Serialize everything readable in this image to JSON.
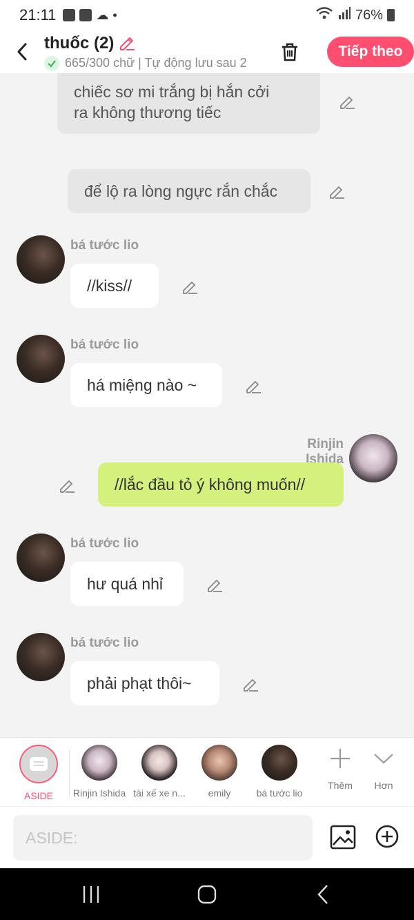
{
  "status": {
    "time": "21:11",
    "battery": "76%"
  },
  "header": {
    "title": "thuốc (2)",
    "subtitle": "665/300 chữ | Tự động lưu sau 2",
    "next_label": "Tiếp theo"
  },
  "messages": [
    {
      "type": "aside",
      "text_lines": [
        "chiếc sơ mi trắng bị hắn cởi",
        "ra không thương tiếc"
      ]
    },
    {
      "type": "aside",
      "text": "để lộ ra lòng ngực rắn chắc"
    },
    {
      "type": "left",
      "sender": "bá tước lio",
      "text": "//kiss//"
    },
    {
      "type": "left",
      "sender": "bá tước lio",
      "text": "há miệng nào ~"
    },
    {
      "type": "right",
      "sender": "Rinjin Ishida",
      "text": "//lắc đầu tỏ ý không muốn//"
    },
    {
      "type": "left",
      "sender": "bá tước lio",
      "text": "hư quá nhỉ"
    },
    {
      "type": "left",
      "sender": "bá tước lio",
      "text": "phải phạt thôi~"
    }
  ],
  "characters": [
    {
      "name": "ASIDE"
    },
    {
      "name": "Rinjin Ishida"
    },
    {
      "name": "tài xế xe n..."
    },
    {
      "name": "emily"
    },
    {
      "name": "bá tước lio"
    }
  ],
  "tools": {
    "add_label": "Thêm",
    "more_label": "Hơn"
  },
  "input": {
    "placeholder": "ASIDE:"
  },
  "colors": {
    "accent": "#ff4e6f",
    "right_bubble": "#d4f07d",
    "aside_bubble": "#e6e6e6"
  }
}
